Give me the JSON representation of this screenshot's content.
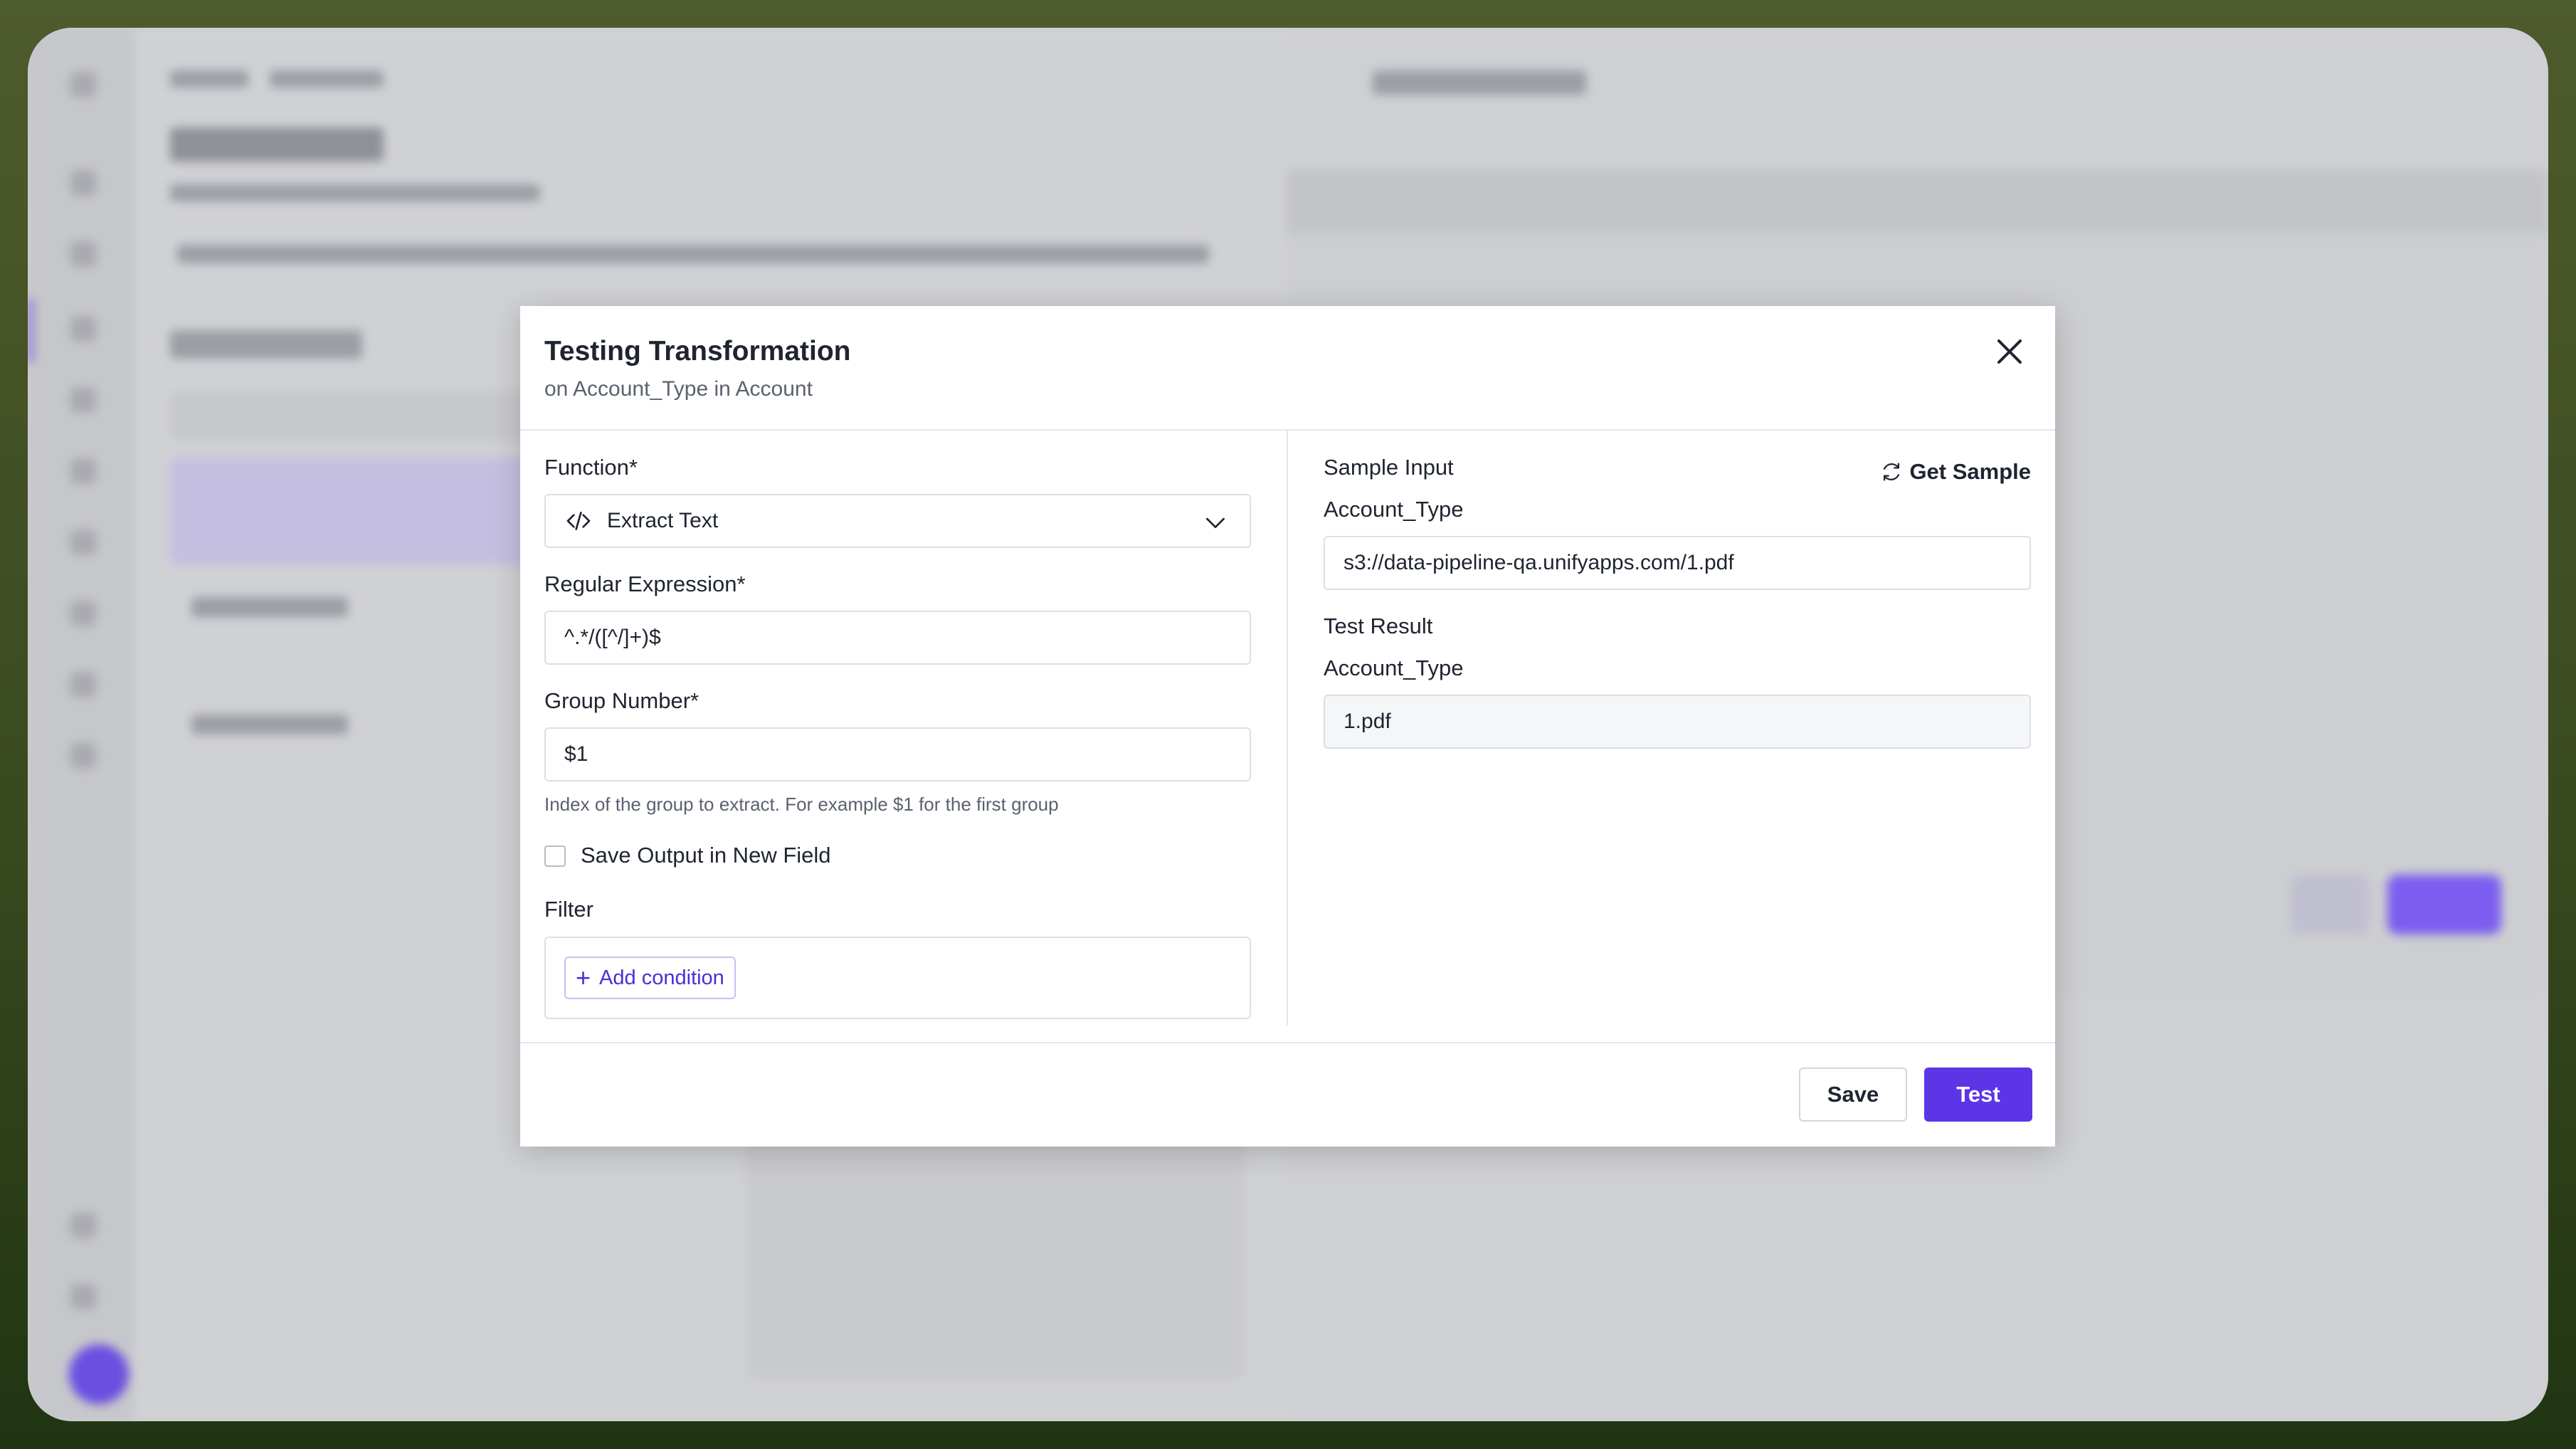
{
  "modal": {
    "title": "Testing Transformation",
    "subtitle": "on Account_Type in Account",
    "close_icon": "close-icon"
  },
  "left": {
    "function_label": "Function*",
    "function_value": "Extract Text",
    "function_icon": "code-icon",
    "regex_label": "Regular Expression*",
    "regex_value": "^.*/([^/]+)$",
    "group_label": "Group Number*",
    "group_value": "$1",
    "group_helper": "Index of the group to extract. For example $1 for the first group",
    "save_output_label": "Save Output in New Field",
    "save_output_checked": false,
    "filter_label": "Filter",
    "add_condition_label": "Add condition"
  },
  "right": {
    "sample_input_label": "Sample Input",
    "get_sample_label": "Get Sample",
    "sample_field_label": "Account_Type",
    "sample_value": "s3://data-pipeline-qa.unifyapps.com/1.pdf",
    "test_result_label": "Test Result",
    "result_field_label": "Account_Type",
    "result_value": "1.pdf"
  },
  "footer": {
    "save_label": "Save",
    "test_label": "Test"
  },
  "colors": {
    "accent": "#5b35e6",
    "accent_text": "#4a2fd6"
  }
}
